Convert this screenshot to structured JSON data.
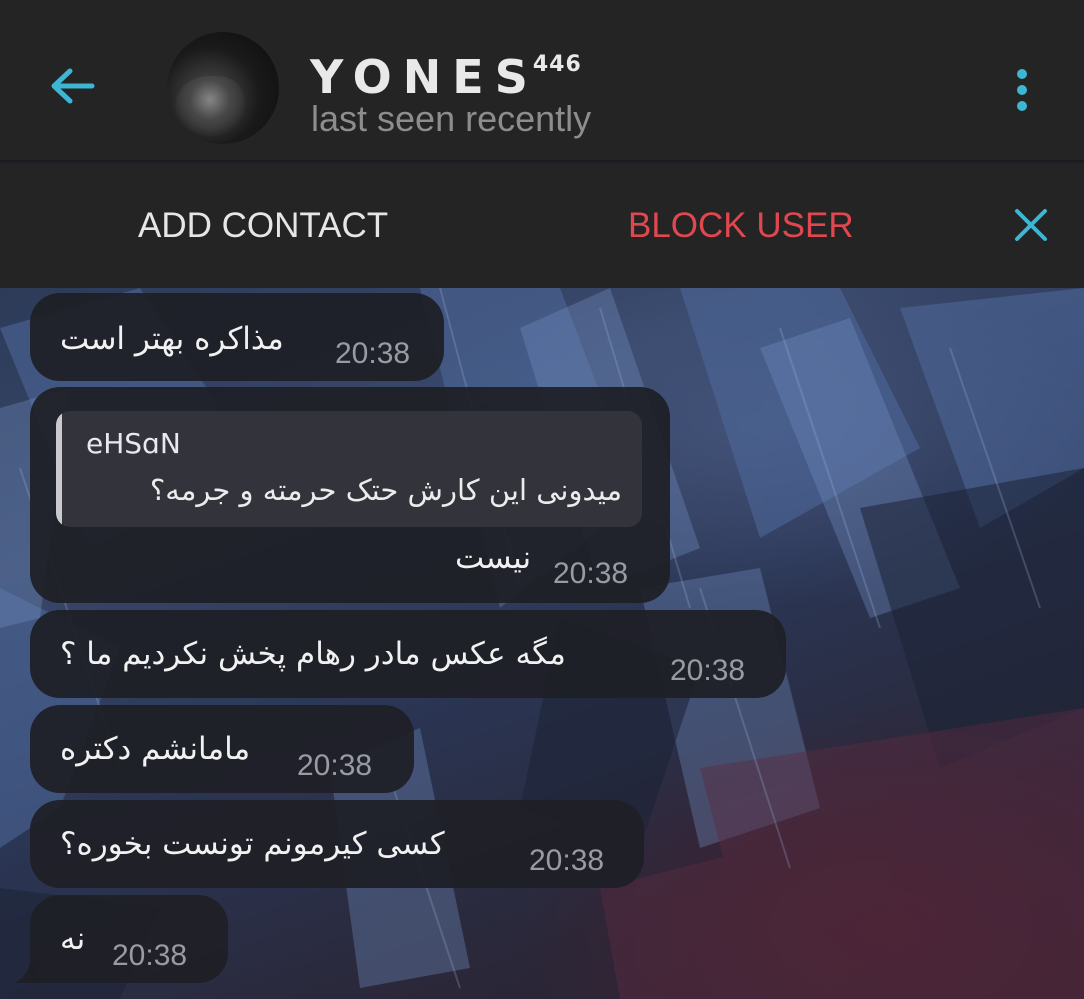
{
  "header": {
    "title": "YONES",
    "title_sup": "446",
    "subtitle": "last seen recently",
    "icons": {
      "back": "arrow-left-icon",
      "menu": "more-vertical-icon"
    },
    "accent_color": "#3cb6d3"
  },
  "action_bar": {
    "add_contact_label": "ADD CONTACT",
    "block_user_label": "BLOCK USER",
    "block_color": "#e0474f",
    "close_icon": "close-icon"
  },
  "messages": [
    {
      "text": "مذاکره بهتر است",
      "time": "20:38"
    },
    {
      "reply_to": {
        "name": "eHSɑN",
        "text": "میدونی این کارش حتک حرمته و جرمه؟"
      },
      "text": "نیست",
      "time": "20:38"
    },
    {
      "text": "مگه عکس مادر رهام پخش نکردیم ما ؟",
      "time": "20:38"
    },
    {
      "text": "مامانشم دکتره",
      "time": "20:38"
    },
    {
      "text": "کسی کیرمونم تونست بخوره؟",
      "time": "20:38"
    },
    {
      "text": "نه",
      "time": "20:38"
    }
  ]
}
